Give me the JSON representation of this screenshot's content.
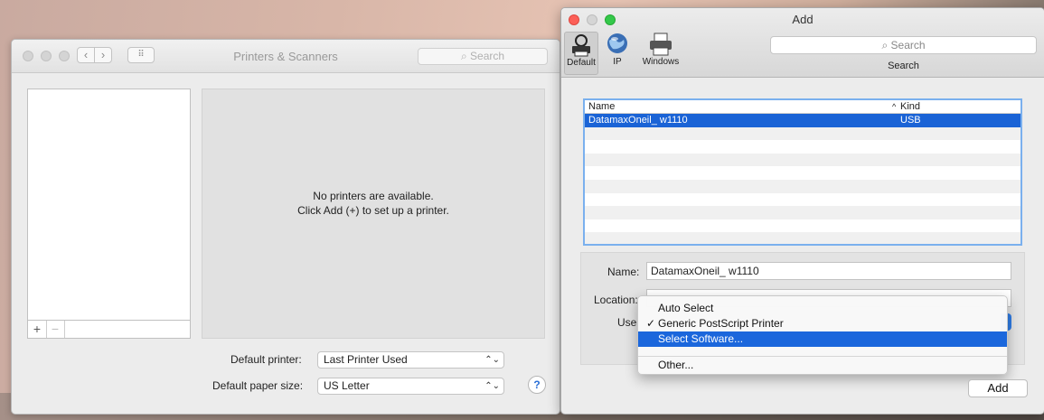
{
  "printers_window": {
    "title": "Printers & Scanners",
    "search_placeholder": "Search",
    "nav": {
      "back": "‹",
      "forward": "›",
      "grid": "⠿"
    },
    "list_buttons": {
      "add": "+",
      "remove": "−"
    },
    "empty_message_line1": "No printers are available.",
    "empty_message_line2": "Click Add (+) to set up a printer.",
    "default_printer_label": "Default printer:",
    "default_printer_value": "Last Printer Used",
    "default_paper_label": "Default paper size:",
    "default_paper_value": "US Letter",
    "help": "?"
  },
  "add_window": {
    "title": "Add",
    "toolbar": [
      {
        "label": "Default",
        "icon": "default-printer-icon",
        "selected": true
      },
      {
        "label": "IP",
        "icon": "globe-icon",
        "selected": false
      },
      {
        "label": "Windows",
        "icon": "windows-printer-icon",
        "selected": false
      }
    ],
    "search_placeholder": "Search",
    "search_label": "Search",
    "table": {
      "col_name": "Name",
      "sort_indicator": "^",
      "col_kind": "Kind",
      "rows": [
        {
          "name": "DatamaxOneil_ w1110",
          "kind": "USB",
          "selected": true
        }
      ]
    },
    "name_label": "Name:",
    "name_value": "DatamaxOneil_ w1110",
    "location_label": "Location:",
    "location_value": "",
    "use_label": "Use",
    "use_menu": {
      "items": [
        {
          "label": "Auto Select",
          "checked": false,
          "highlighted": false
        },
        {
          "label": "Generic PostScript Printer",
          "checked": true,
          "highlighted": false
        },
        {
          "label": "Select Software...",
          "checked": false,
          "highlighted": true
        }
      ],
      "other": "Other...",
      "check_glyph": "✓"
    },
    "add_button": "Add"
  }
}
